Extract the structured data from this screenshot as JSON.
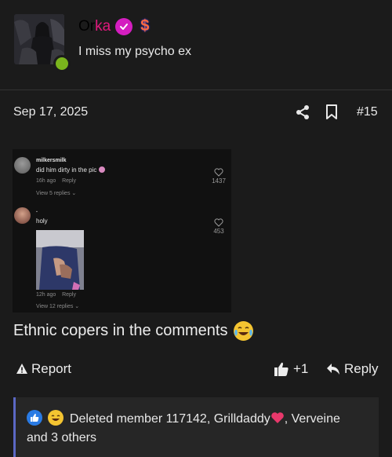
{
  "user": {
    "name_prefix": "Or",
    "name_accent": "ka",
    "tagline": "I miss my psycho ex"
  },
  "post": {
    "date": "Sep 17, 2025",
    "number": "#15",
    "body": "Ethnic copers in the comments"
  },
  "screenshot": {
    "comments": [
      {
        "username": "milkersmilk",
        "text": "did him dirty in the pic",
        "time": "16h ago",
        "reply": "Reply",
        "view_replies": "View 5 replies",
        "likes": "1437"
      },
      {
        "username": ".",
        "text": "holy",
        "time": "12h ago",
        "reply": "Reply",
        "view_replies": "View 12 replies",
        "likes": "453"
      }
    ]
  },
  "actions": {
    "report": "Report",
    "like_count": "+1",
    "reply": "Reply"
  },
  "reactions": {
    "line1": "Deleted member 117142, Grilldaddy",
    "line1_suffix": ", Verveine",
    "line2": "and 3 others"
  },
  "colors": {
    "background": "#1b1b1b",
    "accent_pink": "#e0197d",
    "online_green": "#7ab51d",
    "reaction_bar": "#5b68c4"
  },
  "icons": [
    "verified-icon",
    "dollar-icon",
    "share-icon",
    "bookmark-icon",
    "warning-icon",
    "thumbs-up-icon",
    "reply-icon",
    "heart-icon",
    "crying-laughing-emoji"
  ]
}
